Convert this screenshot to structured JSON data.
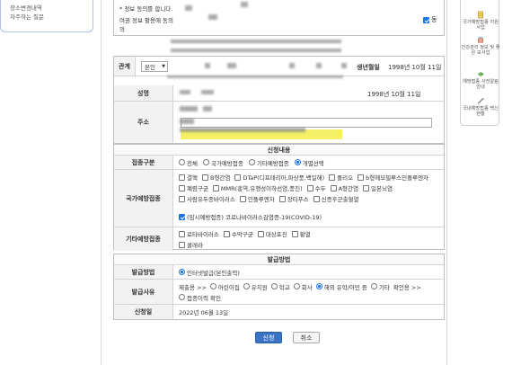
{
  "left_card": {
    "line1": "장소변경내역",
    "line2": "자주하는 질문"
  },
  "consent": {
    "line1": "* 정보 동의를 합니다.",
    "line2": "여권 정보 활용에 동의",
    "line3": "의",
    "checkbox_label": "동"
  },
  "applicant": {
    "relation_label": "관계",
    "relation_value": "본인",
    "birth_label": "생년월일",
    "birth_value": "1998년 10월 11일",
    "name_label": "성명",
    "name_birth_value": "1998년 10월 11일",
    "address_label": "주소"
  },
  "application": {
    "section_title": "신청내용",
    "type_label": "접종구분",
    "type_options": [
      "전체",
      "국가예방접종",
      "기타예방접종",
      "개별선택"
    ],
    "type_selected": "개별선택",
    "national_label": "국가예방접종",
    "national_options": [
      "결핵",
      "B형간염",
      "DTaP(디프테리아,파상풍,백일해)",
      "폴리오",
      "b형헤모필루스인플루엔자",
      "폐렴구균",
      "MMR(홍역,유행성이하선염,풍진)",
      "수두",
      "A형간염",
      "일본뇌염",
      "사람유두종바이러스",
      "인플루엔자",
      "장티푸스",
      "신증후군출혈열"
    ],
    "covid_option": "(임시예방접종) 코로나바이러스감염증-19(COVID-19)",
    "other_label": "기타예방접종",
    "other_options": [
      "로타바이러스",
      "수막구균",
      "대상포진",
      "황열",
      "콜레라"
    ]
  },
  "issuance": {
    "section_title": "발급방법",
    "method_label": "발급방법",
    "method_option": "인터넷발급(본인출력)",
    "reason_label": "발급사유",
    "reason_prefix": "제출용 >>",
    "reason_options": [
      "어린이집",
      "유치원",
      "학교",
      "회사",
      "해외 유학/이민 등",
      "기타"
    ],
    "reason_selected": "해외 유학/이민 등",
    "confirm_prefix": "확인용 >>",
    "confirm_option": "접종이력 확인",
    "date_label": "신청일",
    "date_value": "2022년 06월 13일"
  },
  "buttons": {
    "apply": "신청",
    "cancel": "취소"
  },
  "right_menu": [
    {
      "label": "국가예방접종 지원사업",
      "icon": "document-icon"
    },
    {
      "label": "건강관리 정보 및 좋은 보사업",
      "icon": "box-icon"
    },
    {
      "label": "예방접종 사전알림안내",
      "icon": "megaphone-icon"
    },
    {
      "label": "국내예방접종 백신현황",
      "icon": "syringe-icon"
    }
  ],
  "colors": {
    "accent": "#1a73e8",
    "primary_button": "#3b74c4",
    "highlight": "#f5f066"
  }
}
